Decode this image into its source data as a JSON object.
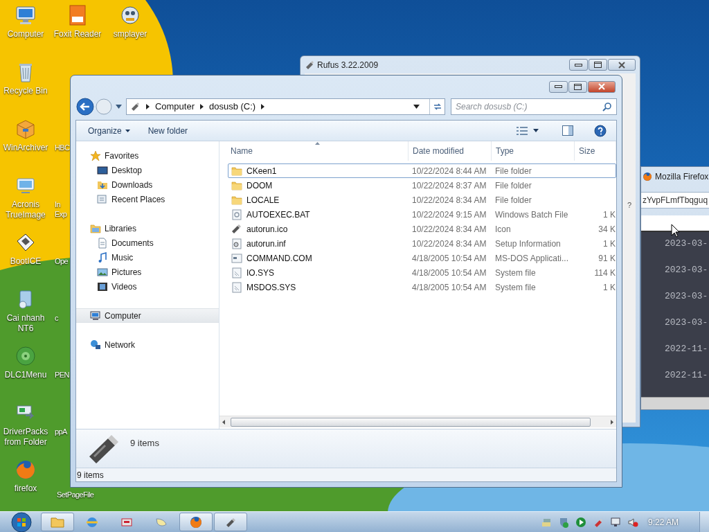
{
  "desktop": {
    "icons": [
      {
        "label": "Computer",
        "kind": "computer"
      },
      {
        "label": "Recycle Bin",
        "kind": "trash"
      },
      {
        "label": "WinArchiver",
        "kind": "archive"
      },
      {
        "label": "Acronis TrueImage",
        "kind": "backup"
      },
      {
        "label": "BootICE",
        "kind": "floppy"
      },
      {
        "label": "Cai nhanh NT6",
        "kind": "installer"
      },
      {
        "label": "DLC1Menu",
        "kind": "disc"
      },
      {
        "label": "DriverPacks from Folder",
        "kind": "drivers"
      },
      {
        "label": "firefox",
        "kind": "firefox"
      }
    ],
    "top_row": [
      {
        "label": "Foxit Reader",
        "kind": "pdf"
      },
      {
        "label": "smplayer",
        "kind": "media"
      }
    ],
    "partly_covered": [
      "HBC",
      "In\nExp",
      "Ope",
      "c",
      "PEN",
      "ppA",
      "SetPageFile"
    ]
  },
  "rufus_window": {
    "title": "Rufus 3.22.2009",
    "help_mark": "?"
  },
  "firefox_window": {
    "title": "Mozilla Firefox",
    "address": "zYvpFLmfTbqguq",
    "dates": [
      "2023-03-",
      "2023-03-",
      "2023-03-",
      "2023-03-",
      "2022-11-",
      "2022-11-"
    ]
  },
  "explorer": {
    "breadcrumb": [
      "Computer",
      "dosusb (C:)"
    ],
    "search": {
      "placeholder": "Search dosusb (C:)"
    },
    "toolbar": [
      "Organize",
      "New folder"
    ],
    "navigation": [
      {
        "label": "Favorites",
        "kind": "star",
        "selected": false,
        "children": [
          {
            "label": "Desktop",
            "kind": "desktop",
            "selected": false
          },
          {
            "label": "Downloads",
            "kind": "downloads",
            "selected": false
          },
          {
            "label": "Recent Places",
            "kind": "recent",
            "selected": false
          }
        ]
      },
      {
        "label": "Libraries",
        "kind": "libraries",
        "selected": false,
        "children": [
          {
            "label": "Documents",
            "kind": "documents",
            "selected": false
          },
          {
            "label": "Music",
            "kind": "music",
            "selected": false
          },
          {
            "label": "Pictures",
            "kind": "pictures",
            "selected": false
          },
          {
            "label": "Videos",
            "kind": "videos",
            "selected": false
          }
        ]
      },
      {
        "label": "Computer",
        "kind": "computer",
        "selected": true
      },
      {
        "label": "Network",
        "kind": "network",
        "selected": false
      }
    ],
    "columns": [
      "Name",
      "Date modified",
      "Type",
      "Size"
    ],
    "files": [
      {
        "name": "CKeen1",
        "date": "10/22/2024 8:44 AM",
        "type": "File folder",
        "kind": "folder",
        "focused": true
      },
      {
        "name": "DOOM",
        "date": "10/22/2024 8:37 AM",
        "type": "File folder",
        "kind": "folder",
        "focused": false
      },
      {
        "name": "LOCALE",
        "date": "10/22/2024 8:34 AM",
        "type": "File folder",
        "kind": "folder",
        "focused": false
      },
      {
        "name": "AUTOEXEC.BAT",
        "date": "10/22/2024 9:15 AM",
        "type": "Windows Batch File",
        "size": "1 K",
        "kind": "batch",
        "focused": false
      },
      {
        "name": "autorun.ico",
        "date": "10/22/2024 8:34 AM",
        "type": "Icon",
        "size": "34 K",
        "kind": "usb",
        "focused": false
      },
      {
        "name": "autorun.inf",
        "date": "10/22/2024 8:34 AM",
        "type": "Setup Information",
        "size": "1 K",
        "kind": "settings",
        "focused": false
      },
      {
        "name": "COMMAND.COM",
        "date": "4/18/2005 10:54 AM",
        "type": "MS-DOS Applicati...",
        "size": "91 K",
        "kind": "app",
        "focused": false
      },
      {
        "name": "IO.SYS",
        "date": "4/18/2005 10:54 AM",
        "type": "System file",
        "size": "114 K",
        "kind": "system",
        "focused": false
      },
      {
        "name": "MSDOS.SYS",
        "date": "4/18/2005 10:54 AM",
        "type": "System file",
        "size": "1 K",
        "kind": "system",
        "focused": false
      }
    ],
    "details_count": "9 items",
    "status": "9 items"
  },
  "taskbar": {
    "items": [
      {
        "kind": "explorer",
        "running": true
      },
      {
        "kind": "browser",
        "running": false
      },
      {
        "kind": "tool",
        "running": false
      },
      {
        "kind": "bird",
        "running": false
      },
      {
        "kind": "firefox",
        "running": true
      },
      {
        "kind": "usb",
        "running": true
      }
    ],
    "tray": [
      {
        "kind": "network"
      },
      {
        "kind": "shield"
      },
      {
        "kind": "play"
      },
      {
        "kind": "flash"
      },
      {
        "kind": "monitor"
      },
      {
        "kind": "sound-muted"
      }
    ],
    "clock": "9:22 AM"
  }
}
